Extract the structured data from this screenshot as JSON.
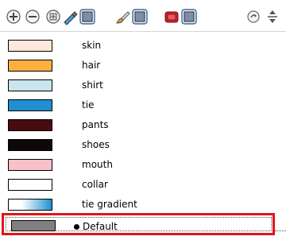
{
  "toolbar": {
    "buttons": [
      {
        "name": "add-color-button",
        "icon": "plus-circle-icon"
      },
      {
        "name": "remove-color-button",
        "icon": "minus-circle-icon"
      },
      {
        "name": "texture-button",
        "icon": "texture-icon"
      },
      {
        "name": "color-picker-button",
        "icon": "eyedropper-icon"
      },
      {
        "name": "swatch-mode-button",
        "icon": "swatch-square-icon"
      },
      {
        "name": "brush-button",
        "icon": "brush-icon"
      },
      {
        "name": "brush-swatch-button",
        "icon": "swatch-square-icon"
      },
      {
        "name": "palette-button",
        "icon": "palette-icon"
      },
      {
        "name": "palette-swatch-button",
        "icon": "swatch-square-icon"
      },
      {
        "name": "link-button",
        "icon": "link-icon"
      },
      {
        "name": "sort-button",
        "icon": "up-down-arrows-icon"
      }
    ]
  },
  "colors": [
    {
      "label": "skin",
      "color": "#fde8dc"
    },
    {
      "label": "hair",
      "color": "#fcb040"
    },
    {
      "label": "shirt",
      "color": "#c8e6ec"
    },
    {
      "label": "tie",
      "color": "#2090d0"
    },
    {
      "label": "pants",
      "color": "#4a0a12"
    },
    {
      "label": "shoes",
      "color": "#100808"
    },
    {
      "label": "mouth",
      "color": "#f8c0c8"
    },
    {
      "label": "collar",
      "color": "#ffffff"
    },
    {
      "label": "tie gradient",
      "color": "gradient",
      "gradient_from": "#ffffff",
      "gradient_to": "#2090d0"
    }
  ],
  "default_color": {
    "label": "Default",
    "color": "#808080",
    "selected_marker": "bullet"
  },
  "highlight_color": "#e0141c"
}
